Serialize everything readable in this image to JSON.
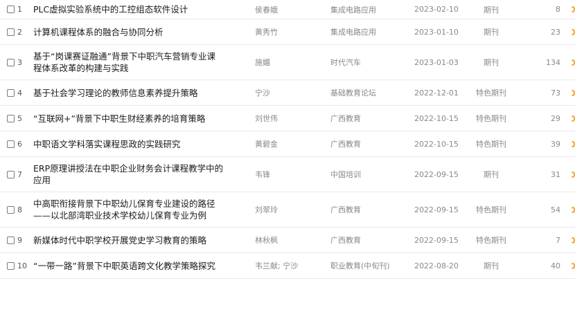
{
  "rows": [
    {
      "num": "1",
      "title": "PLC虚拟实验系统中的工控组态软件设计",
      "author": "侯春娥",
      "source": "集成电路应用",
      "date": "2023-02-10",
      "type": "期刊",
      "cite": "8"
    },
    {
      "num": "2",
      "title": "计算机课程体系的融合与协同分析",
      "author": "黄秀竹",
      "source": "集成电路应用",
      "date": "2023-01-10",
      "type": "期刊",
      "cite": "23"
    },
    {
      "num": "3",
      "title": "基于“岗课赛证融通”背景下中职汽车营销专业课程体系改革的构建与实践",
      "author": "施媚",
      "source": "时代汽车",
      "date": "2023-01-03",
      "type": "期刊",
      "cite": "134"
    },
    {
      "num": "4",
      "title": "基于社会学习理论的教师信息素养提升策略",
      "author": "宁沙",
      "source": "基础教育论坛",
      "date": "2022-12-01",
      "type": "特色期刊",
      "cite": "73"
    },
    {
      "num": "5",
      "title": "“互联网+”背景下中职生财经素养的培育策略",
      "author": "刘世伟",
      "source": "广西教育",
      "date": "2022-10-15",
      "type": "特色期刊",
      "cite": "29"
    },
    {
      "num": "6",
      "title": "中职语文学科落实课程思政的实践研究",
      "author": "黄碧金",
      "source": "广西教育",
      "date": "2022-10-15",
      "type": "特色期刊",
      "cite": "39"
    },
    {
      "num": "7",
      "title": "ERP原理讲授法在中职企业财务会计课程教学中的应用",
      "author": "韦锋",
      "source": "中国培训",
      "date": "2022-09-15",
      "type": "期刊",
      "cite": "31"
    },
    {
      "num": "8",
      "title": "中高职衔接背景下中职幼儿保育专业建设的路径——以北部湾职业技术学校幼儿保育专业为例",
      "author": "刘翠玲",
      "source": "广西教育",
      "date": "2022-09-15",
      "type": "特色期刊",
      "cite": "54"
    },
    {
      "num": "9",
      "title": "新媒体时代中职学校开展党史学习教育的策略",
      "author": "林秋枫",
      "source": "广西教育",
      "date": "2022-09-15",
      "type": "特色期刊",
      "cite": "7"
    },
    {
      "num": "10",
      "title": "“一带一路”背景下中职英语跨文化教学策略探究",
      "author": "韦兰献; 宁沙",
      "source": "职业教育(中旬刊)",
      "date": "2022-08-20",
      "type": "期刊",
      "cite": "40"
    }
  ],
  "title_lines": {
    "2": [
      "基于“岗课赛证融通”背景下中职汽车营销专业课",
      "程体系改革的构建与实践"
    ],
    "6": [
      "ERP原理讲授法在中职企业财务会计课程教学中的",
      "应用"
    ],
    "7": [
      "中高职衔接背景下中职幼儿保育专业建设的路径",
      "——以北部湾职业技术学校幼儿保育专业为例"
    ]
  },
  "colors": {
    "download_icon": "#f0a020",
    "text": "#1a1a1a",
    "meta": "#888888",
    "divider": "#e8e8e8"
  },
  "icons": {
    "download": "download-icon"
  }
}
